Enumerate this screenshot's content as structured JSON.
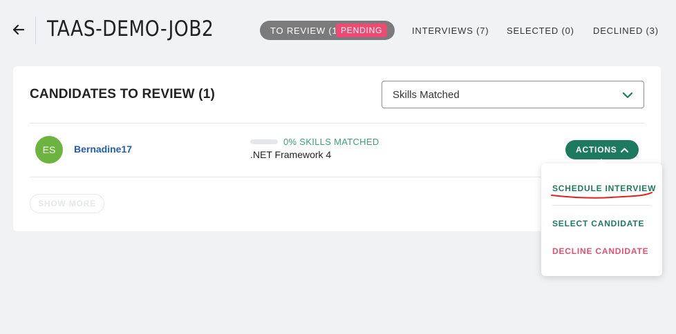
{
  "header": {
    "job_title": "TAAS-DEMO-JOB2",
    "tabs": [
      {
        "label": "TO REVIEW (1)",
        "badge": "PENDING",
        "active": true
      },
      {
        "label": "INTERVIEWS (7)"
      },
      {
        "label": "SELECTED (0)"
      },
      {
        "label": "DECLINED (3)"
      }
    ]
  },
  "card": {
    "title": "CANDIDATES TO REVIEW (1)",
    "filter": {
      "value": "Skills Matched"
    },
    "candidates": [
      {
        "initials": "ES",
        "name": "Bernadine17",
        "skills_matched_percent": 0,
        "skills_matched_label": "0% SKILLS MATCHED",
        "skill": ".NET Framework 4",
        "actions_label": "ACTIONS"
      }
    ],
    "show_more_label": "SHOW MORE"
  },
  "actions_menu": {
    "items": [
      {
        "label": "SCHEDULE INTERVIEW"
      },
      {
        "label": "SELECT CANDIDATE"
      },
      {
        "label": "DECLINE CANDIDATE"
      }
    ]
  },
  "colors": {
    "accent_green": "#1e7a5e",
    "skill_green": "#3aa17e",
    "pending_pink": "#ec4b73",
    "decline_red": "#e0506f",
    "link_blue": "#245ea8",
    "avatar_green": "#6db33f",
    "annotation_red": "#e02020"
  },
  "icons": [
    "arrow-left-icon",
    "chevron-down-icon",
    "chevron-up-icon"
  ]
}
